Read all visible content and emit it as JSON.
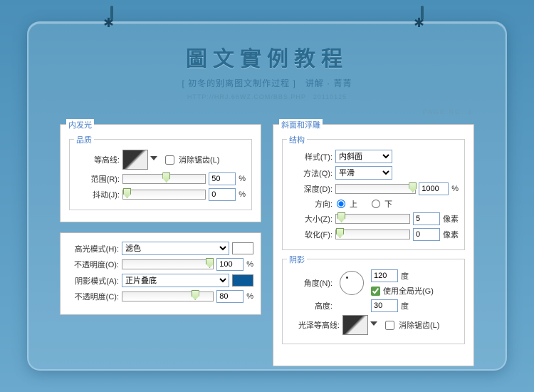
{
  "header": {
    "title": "圖文實例教程",
    "subtitle": "[ 初冬的别离图文制作过程 ]　讲解 · 菁菁",
    "url": "HTTP://HRJ.66WZ.COM/BBS.PHP　20110125",
    "page_no": "PAGE NO. 3"
  },
  "inner_glow": {
    "title": "内发光",
    "quality_group": "品质",
    "contour_label": "等高线:",
    "antialias_label": "消除锯齿(L)",
    "antialias_checked": false,
    "range_label": "范围(R):",
    "range_value": "50",
    "range_unit": "%",
    "jitter_label": "抖动(J):",
    "jitter_value": "0",
    "jitter_unit": "%"
  },
  "highlight": {
    "mode_label": "高光模式(H):",
    "mode_value": "滤色",
    "opacity1_label": "不透明度(O):",
    "opacity1_value": "100",
    "opacity1_unit": "%",
    "shadow_mode_label": "阴影模式(A):",
    "shadow_mode_value": "正片叠底",
    "opacity2_label": "不透明度(C):",
    "opacity2_value": "80",
    "opacity2_unit": "%"
  },
  "bevel": {
    "title": "斜面和浮雕",
    "structure_group": "结构",
    "style_label": "样式(T):",
    "style_value": "内斜面",
    "technique_label": "方法(Q):",
    "technique_value": "平滑",
    "depth_label": "深度(D):",
    "depth_value": "1000",
    "depth_unit": "%",
    "direction_label": "方向:",
    "dir_up": "上",
    "dir_down": "下",
    "size_label": "大小(Z):",
    "size_value": "5",
    "size_unit": "像素",
    "soften_label": "软化(F):",
    "soften_value": "0",
    "soften_unit": "像素",
    "shading_group": "阴影",
    "angle_label": "角度(N):",
    "angle_value": "120",
    "angle_unit": "度",
    "global_light_label": "使用全局光(G)",
    "global_light_checked": true,
    "altitude_label": "高度:",
    "altitude_value": "30",
    "altitude_unit": "度",
    "gloss_label": "光泽等高线:",
    "antialias_label": "消除锯齿(L)",
    "antialias_checked": false
  }
}
